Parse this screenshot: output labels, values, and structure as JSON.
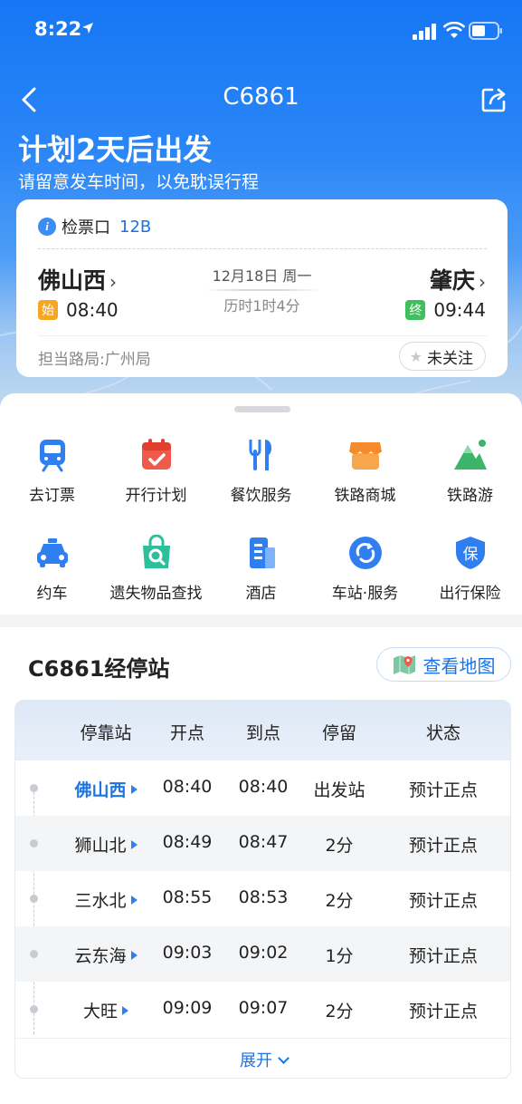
{
  "status_bar": {
    "time": "8:22"
  },
  "nav": {
    "title": "C6861"
  },
  "plan": {
    "title": "计划2天后出发",
    "subtitle": "请留意发车时间，以免耽误行程"
  },
  "ticket": {
    "gate_label": "检票口",
    "gate_no": "12B",
    "departure": {
      "station": "佛山西",
      "tag": "始",
      "time": "08:40"
    },
    "arrival": {
      "station": "肇庆",
      "tag": "终",
      "time": "09:44"
    },
    "date": "12月18日 周一",
    "duration": "历时1时4分",
    "bureau": "担当路局:广州局",
    "follow_label": "未关注"
  },
  "services": [
    {
      "label": "去订票",
      "icon": "train-ticket-icon"
    },
    {
      "label": "开行计划",
      "icon": "calendar-check-icon"
    },
    {
      "label": "餐饮服务",
      "icon": "dining-icon"
    },
    {
      "label": "铁路商城",
      "icon": "shop-icon"
    },
    {
      "label": "铁路游",
      "icon": "mountain-icon"
    },
    {
      "label": "约车",
      "icon": "taxi-icon"
    },
    {
      "label": "遗失物品查找",
      "icon": "lost-found-icon"
    },
    {
      "label": "酒店",
      "icon": "hotel-icon"
    },
    {
      "label": "车站·服务",
      "icon": "station-service-icon"
    },
    {
      "label": "出行保险",
      "icon": "insurance-icon"
    }
  ],
  "stops": {
    "title": "C6861经停站",
    "map_button": "查看地图",
    "columns": [
      "停靠站",
      "开点",
      "到点",
      "停留",
      "状态"
    ],
    "rows": [
      {
        "station": "佛山西",
        "dep": "08:40",
        "arr": "08:40",
        "stay": "出发站",
        "status": "预计正点"
      },
      {
        "station": "狮山北",
        "dep": "08:49",
        "arr": "08:47",
        "stay": "2分",
        "status": "预计正点"
      },
      {
        "station": "三水北",
        "dep": "08:55",
        "arr": "08:53",
        "stay": "2分",
        "status": "预计正点"
      },
      {
        "station": "云东海",
        "dep": "09:03",
        "arr": "09:02",
        "stay": "1分",
        "status": "预计正点"
      },
      {
        "station": "大旺",
        "dep": "09:09",
        "arr": "09:07",
        "stay": "2分",
        "status": "预计正点"
      }
    ],
    "expand_label": "展开"
  },
  "colors": {
    "accent": "#1a73e8",
    "header_blue": "#1677f5"
  }
}
